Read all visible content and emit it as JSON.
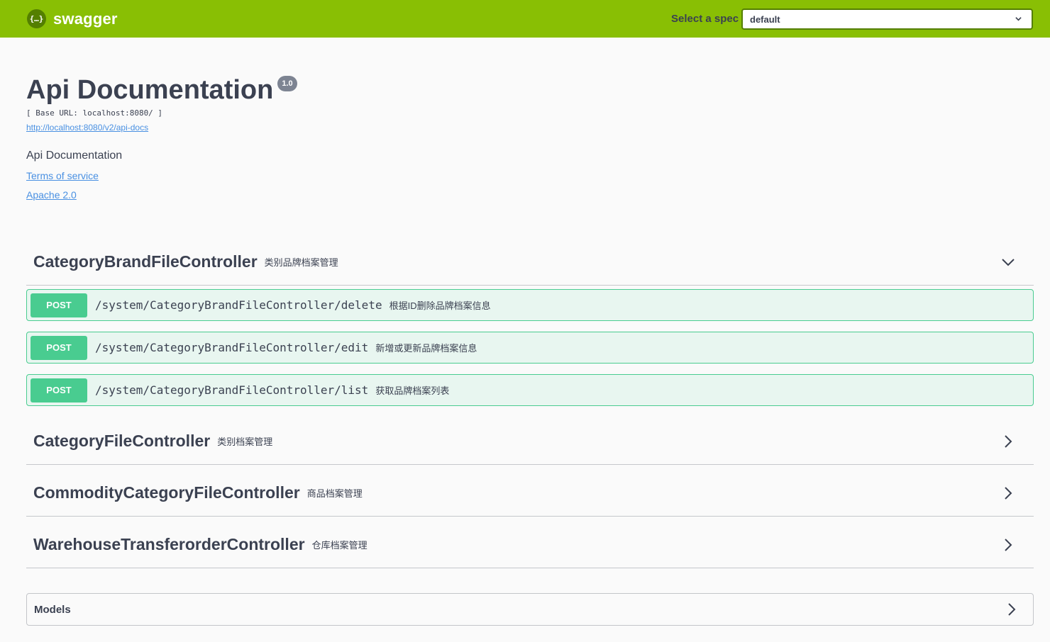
{
  "topbar": {
    "logo_symbol": "{…}",
    "brand": "swagger",
    "spec_label": "Select a spec",
    "spec_value": "default",
    "color": "#89bf04"
  },
  "info": {
    "title": "Api Documentation",
    "version": "1.0",
    "base_url": "[ Base URL: localhost:8080/ ]",
    "spec_link": "http://localhost:8080/v2/api-docs",
    "description": "Api Documentation",
    "terms": "Terms of service",
    "license": "Apache 2.0"
  },
  "tags": [
    {
      "name": "CategoryBrandFileController",
      "description": "类别品牌档案管理",
      "expanded": true,
      "operations": [
        {
          "method": "POST",
          "path": "/system/CategoryBrandFileController/delete",
          "summary": "根据ID删除品牌档案信息"
        },
        {
          "method": "POST",
          "path": "/system/CategoryBrandFileController/edit",
          "summary": "新增或更新品牌档案信息"
        },
        {
          "method": "POST",
          "path": "/system/CategoryBrandFileController/list",
          "summary": "获取品牌档案列表"
        }
      ]
    },
    {
      "name": "CategoryFileController",
      "description": "类别档案管理",
      "expanded": false
    },
    {
      "name": "CommodityCategoryFileController",
      "description": "商品档案管理",
      "expanded": false
    },
    {
      "name": "WarehouseTransferorderController",
      "description": "仓库档案管理",
      "expanded": false
    }
  ],
  "models": {
    "label": "Models"
  },
  "colors": {
    "post": "#49cc90",
    "post_bg": "#e8f6f0",
    "link": "#4990e2"
  }
}
